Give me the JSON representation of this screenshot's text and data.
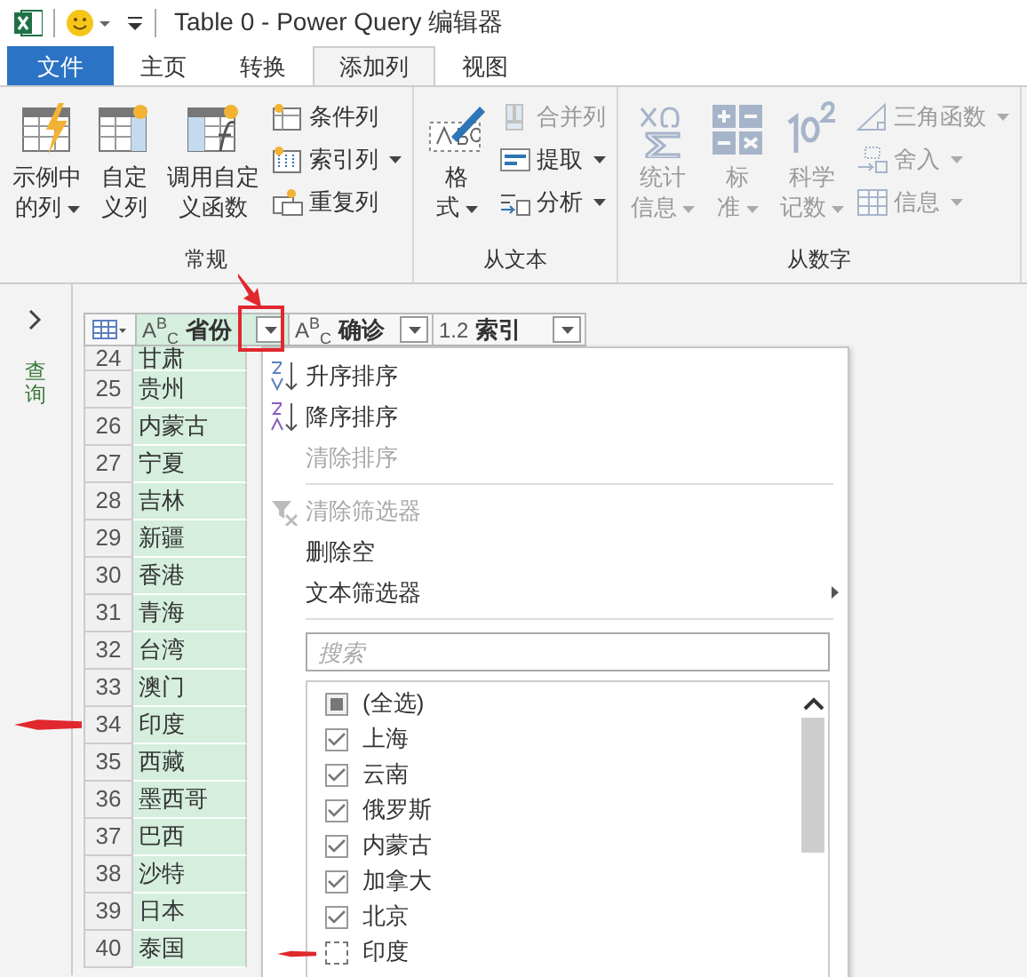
{
  "window": {
    "title": "Table 0 - Power Query 编辑器"
  },
  "tabs": [
    {
      "label": "文件",
      "kind": "file",
      "selected": false
    },
    {
      "label": "主页",
      "kind": "tab",
      "selected": false
    },
    {
      "label": "转换",
      "kind": "tab",
      "selected": false
    },
    {
      "label": "添加列",
      "kind": "tab",
      "selected": true
    },
    {
      "label": "视图",
      "kind": "tab",
      "selected": false
    }
  ],
  "ribbon": {
    "groups": [
      {
        "label": "常规",
        "items": [
          {
            "kind": "large",
            "lines": [
              "示例中",
              "的列"
            ],
            "dropdown": true,
            "disabled": false
          },
          {
            "kind": "large",
            "lines": [
              "自定",
              "义列"
            ],
            "dropdown": false,
            "disabled": false
          },
          {
            "kind": "large",
            "lines": [
              "调用自定",
              "义函数"
            ],
            "dropdown": false,
            "disabled": false
          },
          {
            "kind": "small",
            "lines": [
              "条件列"
            ],
            "dropdown": false,
            "disabled": false
          },
          {
            "kind": "small",
            "lines": [
              "索引列"
            ],
            "dropdown": true,
            "disabled": false
          },
          {
            "kind": "small",
            "lines": [
              "重复列"
            ],
            "dropdown": false,
            "disabled": false
          }
        ]
      },
      {
        "label": "从文本",
        "items": [
          {
            "kind": "large",
            "lines": [
              "格",
              "式"
            ],
            "dropdown": true,
            "disabled": false
          },
          {
            "kind": "small",
            "lines": [
              "合并列"
            ],
            "dropdown": false,
            "disabled": true
          },
          {
            "kind": "small",
            "lines": [
              "提取"
            ],
            "dropdown": true,
            "disabled": false
          },
          {
            "kind": "small",
            "lines": [
              "分析"
            ],
            "dropdown": true,
            "disabled": false
          }
        ]
      },
      {
        "label": "从数字",
        "items": [
          {
            "kind": "large",
            "lines": [
              "统计",
              "信息"
            ],
            "dropdown": true,
            "disabled": true
          },
          {
            "kind": "large",
            "lines": [
              "标",
              "准"
            ],
            "dropdown": true,
            "disabled": true
          },
          {
            "kind": "large",
            "lines": [
              "科学",
              "记数"
            ],
            "dropdown": true,
            "disabled": true
          },
          {
            "kind": "small",
            "lines": [
              "三角函数"
            ],
            "dropdown": true,
            "disabled": true
          },
          {
            "kind": "small",
            "lines": [
              "舍入"
            ],
            "dropdown": true,
            "disabled": true
          },
          {
            "kind": "small",
            "lines": [
              "信息"
            ],
            "dropdown": true,
            "disabled": true
          }
        ]
      }
    ]
  },
  "queries_pane": {
    "label": "查询"
  },
  "table": {
    "columns": [
      {
        "type": "A$^{B}$$_{C}$",
        "label": "省份",
        "selected": true
      },
      {
        "type": "A$^{B}$$_{C}$",
        "label": "确诊",
        "selected": false
      },
      {
        "type": "1.2",
        "label": "索引",
        "selected": false
      }
    ],
    "rows": [
      {
        "index": "24",
        "value": "甘肃"
      },
      {
        "index": "25",
        "value": "贵州"
      },
      {
        "index": "26",
        "value": "内蒙古"
      },
      {
        "index": "27",
        "value": "宁夏"
      },
      {
        "index": "28",
        "value": "吉林"
      },
      {
        "index": "29",
        "value": "新疆"
      },
      {
        "index": "30",
        "value": "香港"
      },
      {
        "index": "31",
        "value": "青海"
      },
      {
        "index": "32",
        "value": "台湾"
      },
      {
        "index": "33",
        "value": "澳门"
      },
      {
        "index": "34",
        "value": "印度"
      },
      {
        "index": "35",
        "value": "西藏"
      },
      {
        "index": "36",
        "value": "墨西哥"
      },
      {
        "index": "37",
        "value": "巴西"
      },
      {
        "index": "38",
        "value": "沙特"
      },
      {
        "index": "39",
        "value": "日本"
      },
      {
        "index": "40",
        "value": "泰国"
      }
    ]
  },
  "filter_menu": {
    "items": [
      {
        "kind": "sort-asc",
        "label": "升序排序",
        "disabled": false,
        "submenu": false
      },
      {
        "kind": "sort-desc",
        "label": "降序排序",
        "disabled": false,
        "submenu": false
      },
      {
        "kind": "plain",
        "label": "清除排序",
        "disabled": true,
        "submenu": false
      },
      {
        "kind": "separator"
      },
      {
        "kind": "clear-filter",
        "label": "清除筛选器",
        "disabled": true,
        "submenu": false
      },
      {
        "kind": "plain",
        "label": "删除空",
        "disabled": false,
        "submenu": false
      },
      {
        "kind": "plain",
        "label": "文本筛选器",
        "disabled": false,
        "submenu": true
      },
      {
        "kind": "separator"
      }
    ],
    "search": {
      "placeholder": "搜索"
    },
    "values": [
      {
        "label": "(全选)",
        "checked": false,
        "indeterminate": true
      },
      {
        "label": "上海",
        "checked": true,
        "indeterminate": false
      },
      {
        "label": "云南",
        "checked": true,
        "indeterminate": false
      },
      {
        "label": "俄罗斯",
        "checked": true,
        "indeterminate": false
      },
      {
        "label": "内蒙古",
        "checked": true,
        "indeterminate": false
      },
      {
        "label": "加拿大",
        "checked": true,
        "indeterminate": false
      },
      {
        "label": "北京",
        "checked": true,
        "indeterminate": false
      },
      {
        "label": "印度",
        "checked": false,
        "indeterminate": false
      }
    ]
  },
  "annotations": [
    {
      "kind": "frame"
    },
    {
      "kind": "arrow-down"
    },
    {
      "kind": "row-arrow"
    },
    {
      "kind": "item-arrow"
    }
  ]
}
